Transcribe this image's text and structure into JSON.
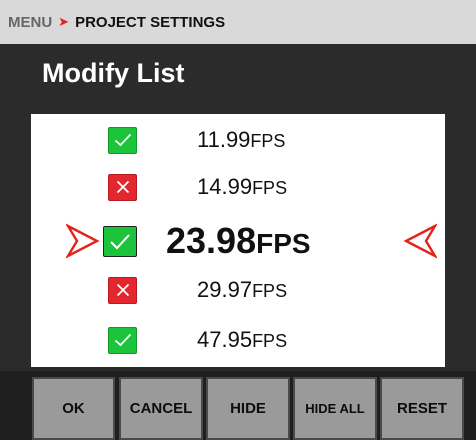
{
  "breadcrumb": {
    "root": "MENU",
    "separator": "➤",
    "current": "PROJECT SETTINGS"
  },
  "title": "Modify List",
  "colors": {
    "enabled": "#1bc43a",
    "disabled": "#e2282e",
    "accent": "#e32219",
    "button": "#9a9a9a"
  },
  "list": {
    "items": [
      {
        "value": "11.99",
        "unit": "FPS",
        "enabled": true,
        "selected": false
      },
      {
        "value": "14.99",
        "unit": "FPS",
        "enabled": false,
        "selected": false
      },
      {
        "value": "23.98",
        "unit": "FPS",
        "enabled": true,
        "selected": true
      },
      {
        "value": "29.97",
        "unit": "FPS",
        "enabled": false,
        "selected": false
      },
      {
        "value": "47.95",
        "unit": "FPS",
        "enabled": true,
        "selected": false
      }
    ],
    "selection_indicator_icons": [
      "arrow-right-icon",
      "arrow-left-icon"
    ]
  },
  "buttons": {
    "ok": "OK",
    "cancel": "CANCEL",
    "hide": "HIDE",
    "hide_all": "HIDE ALL",
    "reset": "RESET"
  }
}
